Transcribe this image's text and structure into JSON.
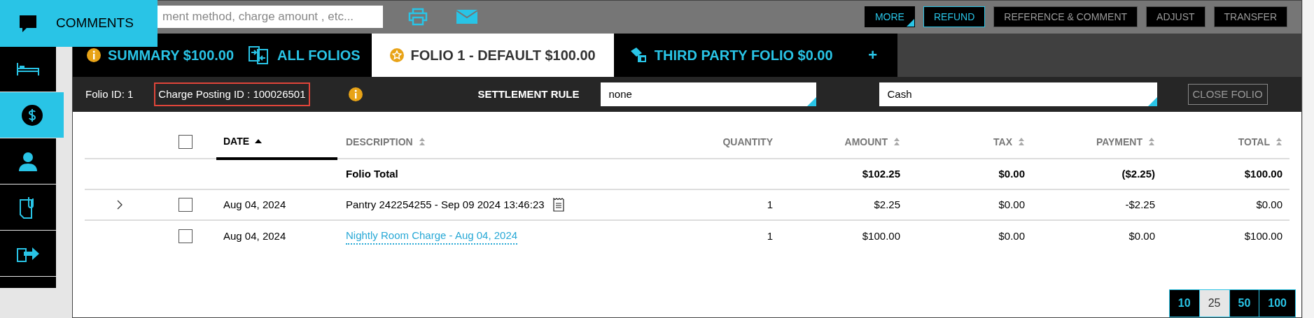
{
  "sidebar": {
    "items": [
      {
        "kind": "comment",
        "active": true,
        "flyout_label": "COMMENTS"
      },
      {
        "kind": "bed",
        "active": false
      },
      {
        "kind": "dollar",
        "active": true
      },
      {
        "kind": "user",
        "active": false
      },
      {
        "kind": "clipboard",
        "active": false
      },
      {
        "kind": "export",
        "active": false
      }
    ]
  },
  "toolbar": {
    "search": {
      "placeholder": "ment method, charge amount , etc..."
    },
    "buttons": [
      {
        "label": "MORE",
        "kind": "more"
      },
      {
        "label": "REFUND",
        "kind": "outlined"
      },
      {
        "label": "REFERENCE & COMMENT",
        "kind": "plain"
      },
      {
        "label": "ADJUST",
        "kind": "plain"
      },
      {
        "label": "TRANSFER",
        "kind": "plain"
      }
    ]
  },
  "tabs": [
    {
      "label": "SUMMARY $100.00",
      "kind": "info",
      "selected": false
    },
    {
      "label": "ALL FOLIOS",
      "kind": "folios",
      "selected": false
    },
    {
      "label": "FOLIO 1 - DEFAULT $100.00",
      "kind": "star",
      "selected": true
    },
    {
      "label": "THIRD PARTY FOLIO $0.00",
      "kind": "third_party",
      "selected": false
    }
  ],
  "add_tab": "+",
  "folio_bar": {
    "folio_id": "Folio ID: 1",
    "charge_posting_id": "Charge Posting ID : 100026501",
    "settlement_label": "SETTLEMENT RULE",
    "settlement_rule": "none",
    "payment_method": "Cash",
    "close_button": "CLOSE FOLIO"
  },
  "table": {
    "columns": [
      {
        "label": "DATE",
        "sortable": true,
        "sorted": true
      },
      {
        "label": "DESCRIPTION",
        "sortable": true,
        "sorted": false
      },
      {
        "label": "QUANTITY",
        "sortable": false,
        "sorted": false
      },
      {
        "label": "AMOUNT",
        "sortable": true,
        "sorted": false
      },
      {
        "label": "TAX",
        "sortable": true,
        "sorted": false
      },
      {
        "label": "PAYMENT",
        "sortable": true,
        "sorted": false
      },
      {
        "label": "TOTAL",
        "sortable": true,
        "sorted": false
      }
    ],
    "select_all": {
      "checked": false
    },
    "rows": [
      {
        "kind": "total",
        "description": "Folio Total",
        "amount": "$102.25",
        "tax": "$0.00",
        "payment": "($2.25)",
        "total": "$100.00"
      },
      {
        "kind": "charge",
        "expandable": true,
        "checked": false,
        "date": "Aug 04, 2024",
        "description": "Pantry 242254255 - Sep 09 2024 13:46:23",
        "link": false,
        "receipt": true,
        "quantity": "1",
        "amount": "$2.25",
        "tax": "$0.00",
        "payment": "-$2.25",
        "total": "$0.00"
      },
      {
        "kind": "charge",
        "expandable": false,
        "checked": false,
        "date": "Aug 04, 2024",
        "description": "Nightly Room Charge - Aug 04, 2024",
        "link": true,
        "receipt": false,
        "quantity": "1",
        "amount": "$100.00",
        "tax": "$0.00",
        "payment": "$0.00",
        "total": "$100.00"
      }
    ]
  },
  "page_sizes": [
    {
      "label": "10",
      "selected": false
    },
    {
      "label": "25",
      "selected": true
    },
    {
      "label": "50",
      "selected": false
    },
    {
      "label": "100",
      "selected": false
    }
  ]
}
